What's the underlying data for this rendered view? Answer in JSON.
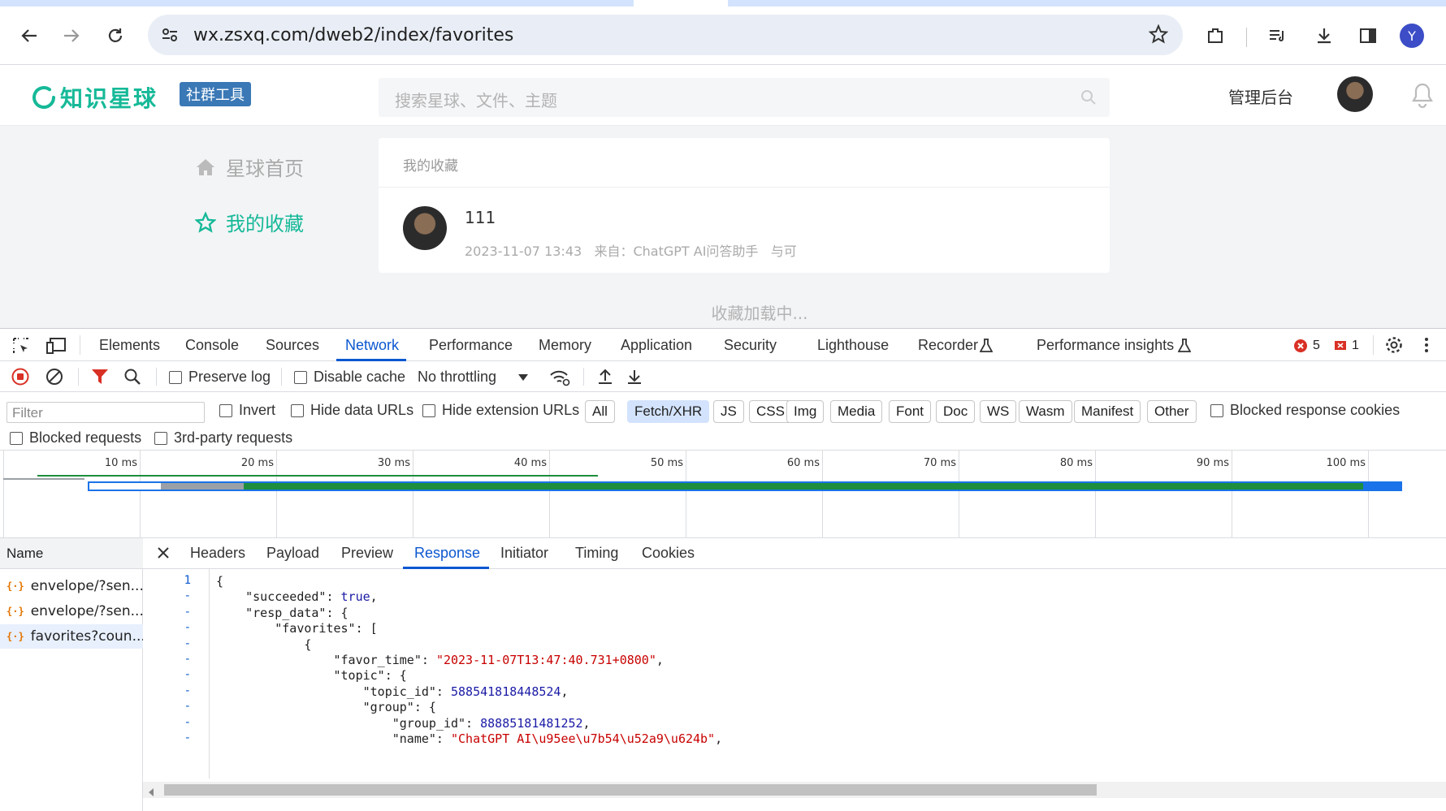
{
  "browser": {
    "url": "wx.zsxq.com/dweb2/index/favorites",
    "profile_initial": "Y"
  },
  "site": {
    "logo": "知识星球",
    "logo_badge": "社群工具",
    "search_placeholder": "搜索星球、文件、主题",
    "admin_link": "管理后台",
    "sidebar": [
      {
        "label": "星球首页",
        "icon": "home-icon",
        "active": false
      },
      {
        "label": "我的收藏",
        "icon": "star-icon",
        "active": true
      }
    ],
    "favorites_title": "我的收藏",
    "favorite": {
      "title": "111",
      "time": "2023-11-07 13:43",
      "source": "来自：ChatGPT AI问答助手",
      "author": "与可"
    },
    "loading": "收藏加载中..."
  },
  "devtools": {
    "tabs": [
      "Elements",
      "Console",
      "Sources",
      "Network",
      "Performance",
      "Memory",
      "Application",
      "Security",
      "Lighthouse",
      "Recorder",
      "Performance insights"
    ],
    "active_tab": "Network",
    "error_count": "5",
    "issue_count": "1",
    "toolbar": {
      "preserve_log": "Preserve log",
      "disable_cache": "Disable cache",
      "throttling": "No throttling"
    },
    "filter_placeholder": "Filter",
    "filter_options": {
      "invert": "Invert",
      "hide_data_urls": "Hide data URLs",
      "hide_extension_urls": "Hide extension URLs",
      "blocked_cookies": "Blocked response cookies",
      "blocked_requests": "Blocked requests",
      "third_party": "3rd-party requests"
    },
    "type_chips": [
      "All",
      "Fetch/XHR",
      "JS",
      "CSS",
      "Img",
      "Media",
      "Font",
      "Doc",
      "WS",
      "Wasm",
      "Manifest",
      "Other"
    ],
    "active_chip": "Fetch/XHR",
    "timeline_ticks": [
      "10 ms",
      "20 ms",
      "30 ms",
      "40 ms",
      "50 ms",
      "60 ms",
      "70 ms",
      "80 ms",
      "90 ms",
      "100 ms"
    ],
    "name_header": "Name",
    "requests": [
      "envelope/?sen...",
      "envelope/?sen...",
      "favorites?coun..."
    ],
    "selected_request": 2,
    "detail_tabs": [
      "Headers",
      "Payload",
      "Preview",
      "Response",
      "Initiator",
      "Timing",
      "Cookies"
    ],
    "active_detail_tab": "Response",
    "line_numbers": [
      "1",
      "-",
      "-",
      "-",
      "-",
      "-",
      "-",
      "-",
      "-",
      "-",
      "-"
    ],
    "response_lines": [
      "{",
      "    \"succeeded\": true,",
      "    \"resp_data\": {",
      "        \"favorites\": [",
      "            {",
      "                \"favor_time\": \"2023-11-07T13:47:40.731+0800\",",
      "                \"topic\": {",
      "                    \"topic_id\": 588541818448524,",
      "                    \"group\": {",
      "                        \"group_id\": 88885181481252,",
      "                        \"name\": \"ChatGPT AI\\u95ee\\u7b54\\u52a9\\u624b\","
    ]
  }
}
